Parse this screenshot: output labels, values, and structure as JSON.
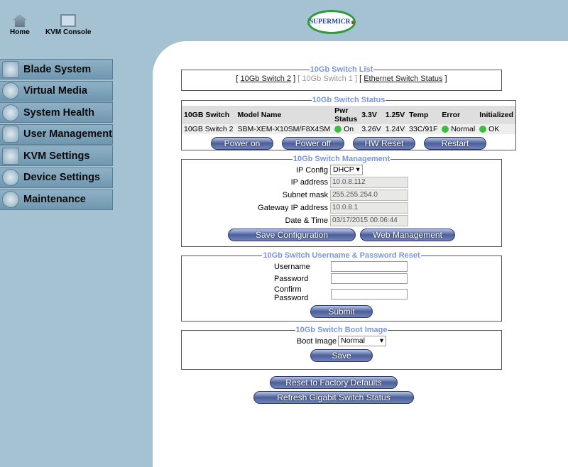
{
  "top": {
    "home": "Home",
    "kvm_console": "KVM Console",
    "logo": "SUPERMICRO"
  },
  "menu": [
    "Blade System",
    "Virtual Media",
    "System Health",
    "User Management",
    "KVM Settings",
    "Device Settings",
    "Maintenance"
  ],
  "switch_list": {
    "title": "10Gb Switch List",
    "links": [
      "10Gb Switch 2",
      "10Gb Switch 1",
      "Ethernet Switch Status"
    ]
  },
  "status": {
    "title": "10Gb Switch Status",
    "headers": [
      "10GB Switch",
      "Model Name",
      "Pwr Status",
      "3.3V",
      "1.25V",
      "Temp",
      "Error",
      "Initialized"
    ],
    "row": [
      "10GB Switch 2",
      "SBM-XEM-X10SM/F8X4SM",
      "On",
      "3.26V",
      "1.24V",
      "33C/91F",
      "Normal",
      "OK"
    ],
    "buttons": [
      "Power on",
      "Power off",
      "HW Reset",
      "Restart"
    ]
  },
  "management": {
    "title": "10Gb Switch Management",
    "ip_config_label": "IP Config",
    "ip_config": "DHCP",
    "ip_label": "IP address",
    "ip": "10.0.8.112",
    "mask_label": "Subnet mask",
    "mask": "255.255.254.0",
    "gw_label": "Gateway IP address",
    "gw": "10.0.8.1",
    "dt_label": "Date & Time",
    "dt": "03/17/2015 00:06:44",
    "save": "Save Configuration",
    "web": "Web Management"
  },
  "reset": {
    "title": "10Gb Switch Username & Password Reset",
    "username": "Username",
    "password": "Password",
    "confirm": "Confirm Password",
    "submit": "Submit"
  },
  "boot": {
    "title": "10Gb Switch Boot Image",
    "label": "Boot Image",
    "value": "Normal",
    "save": "Save"
  },
  "bottom": {
    "factory": "Reset to Factory Defaults",
    "refresh": "Refresh Gigabit Switch Status"
  }
}
